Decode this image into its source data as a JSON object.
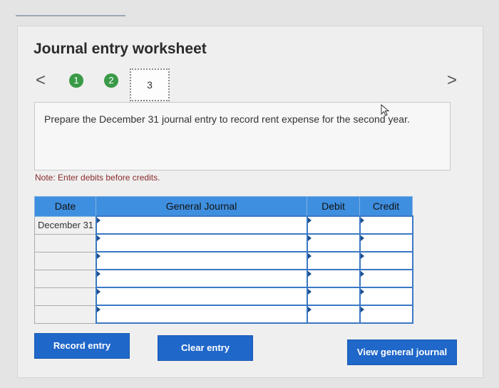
{
  "worksheet": {
    "title": "Journal entry worksheet",
    "nav": {
      "prev": "<",
      "next": ">"
    },
    "steps": [
      "1",
      "2",
      "3"
    ],
    "instruction": "Prepare the December 31 journal entry to record rent expense for the second year.",
    "note": "Note: Enter debits before credits."
  },
  "journal": {
    "headers": {
      "date": "Date",
      "general_journal": "General Journal",
      "debit": "Debit",
      "credit": "Credit"
    },
    "rows": [
      {
        "date": "December 31",
        "account": "",
        "debit": "",
        "credit": ""
      },
      {
        "date": "",
        "account": "",
        "debit": "",
        "credit": ""
      },
      {
        "date": "",
        "account": "",
        "debit": "",
        "credit": ""
      },
      {
        "date": "",
        "account": "",
        "debit": "",
        "credit": ""
      },
      {
        "date": "",
        "account": "",
        "debit": "",
        "credit": ""
      },
      {
        "date": "",
        "account": "",
        "debit": "",
        "credit": ""
      }
    ]
  },
  "buttons": {
    "record": "Record entry",
    "clear": "Clear entry",
    "view": "View general journal"
  },
  "colors": {
    "accent": "#1f67c9",
    "step_complete": "#3a9a47",
    "header_blue": "#3f8fe0",
    "note_text": "#8a2b2b"
  },
  "icons": {
    "cursor": "mouse-cursor-icon"
  }
}
